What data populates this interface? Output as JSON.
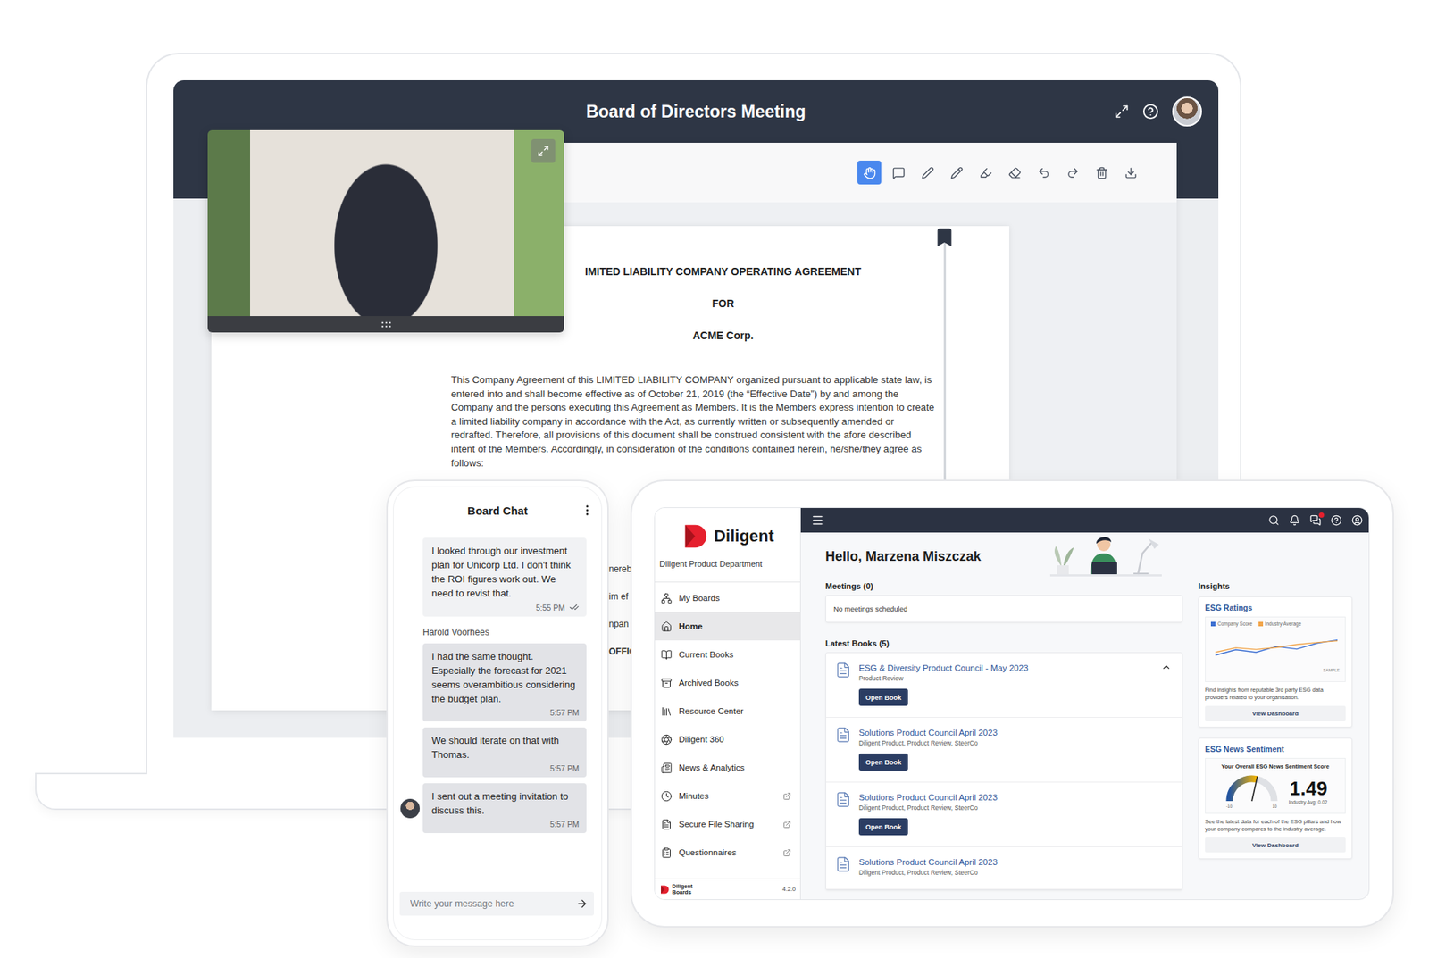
{
  "laptop": {
    "title": "Board of Directors Meeting",
    "tools": [
      {
        "selected": true
      },
      {
        "selected": false
      },
      {
        "selected": false
      },
      {
        "selected": false
      },
      {
        "selected": false
      },
      {
        "selected": false
      },
      {
        "selected": false
      },
      {
        "selected": false
      },
      {
        "selected": false
      },
      {
        "selected": false
      }
    ],
    "document": {
      "bookmarked": true,
      "title_lines": [
        "IMITED LIABILITY COMPANY OPERATING AGREEMENT",
        "FOR",
        "ACME Corp."
      ],
      "body": "This Company Agreement of this LIMITED LIABILITY COMPANY organized pursuant to applicable state law, is entered into and shall become effective as of October 21, 2019 (the “Effective Date”) by and among the Company and the persons executing this Agreement as Members. It is the Members express intention to create a limited liability company in accordance with the Act, as currently written or subsequently amended or redrafted. Therefore, all provisions of this document shall be construed consistent with the afore described intent of the Members. Accordingly, in consideration of the conditions contained herein, he/she/they agree as follows:",
      "fragments": [
        "nereb",
        "im ef",
        "npan",
        "OFFIC"
      ]
    }
  },
  "chat": {
    "title": "Board Chat",
    "messages": [
      {
        "own": true,
        "avatar": false,
        "read": true,
        "text": "I looked through our investment plan for Unicorp Ltd. I don't think the ROI figures work out. We need to revist that.",
        "time": "5:55 PM"
      },
      {
        "own": false,
        "avatar": false,
        "read": false,
        "sender": "Harold Voorhees",
        "text": "I had the same thought. Especially the forecast for 2021 seems overambitious considering the budget plan.",
        "time": "5:57 PM"
      },
      {
        "own": false,
        "avatar": false,
        "read": false,
        "text": "We should iterate on that with Thomas.",
        "time": "5:57 PM"
      },
      {
        "own": false,
        "avatar": true,
        "read": false,
        "text": "I sent out a meeting invitation to discuss this.",
        "time": "5:57 PM"
      }
    ],
    "input_placeholder": "Write your message here"
  },
  "dashboard": {
    "brand": {
      "name": "Diligent",
      "department": "Diligent Product Department"
    },
    "nav": [
      {
        "label": "My Boards",
        "selected": false,
        "external": false
      },
      {
        "label": "Home",
        "selected": true,
        "external": false
      },
      {
        "label": "Current Books",
        "selected": false,
        "external": false
      },
      {
        "label": "Archived Books",
        "selected": false,
        "external": false
      },
      {
        "label": "Resource Center",
        "selected": false,
        "external": false
      },
      {
        "label": "Diligent 360",
        "selected": false,
        "external": false
      },
      {
        "label": "News & Analytics",
        "selected": false,
        "external": false
      },
      {
        "label": "Minutes",
        "selected": false,
        "external": true
      },
      {
        "label": "Secure File Sharing",
        "selected": false,
        "external": true
      },
      {
        "label": "Questionnaires",
        "selected": false,
        "external": true
      }
    ],
    "footer": {
      "brand": "Diligent",
      "product": "Boards",
      "version": "4.2.0"
    },
    "topbar": {
      "unread_messages": true
    },
    "greeting": "Hello, Marzena Miszczak",
    "meetings": {
      "label": "Meetings (0)",
      "empty": "No meetings scheduled"
    },
    "books": {
      "label": "Latest Books (5)",
      "items": [
        {
          "title": "ESG & Diversity Product Council - May 2023",
          "tags": "Product Review",
          "button": "Open Book",
          "expanded": true
        },
        {
          "title": "Solutions Product Council April 2023",
          "tags": "Diligent Product, Product Review, SteerCo",
          "button": "Open Book",
          "expanded": false
        },
        {
          "title": "Solutions Product Council April 2023",
          "tags": "Diligent Product, Product Review, SteerCo",
          "button": "Open Book",
          "expanded": false
        },
        {
          "title": "Solutions Product Council April 2023",
          "tags": "Diligent Product, Product Review, SteerCo",
          "expanded": false
        }
      ]
    },
    "insights": {
      "label": "Insights",
      "ratings": {
        "title": "ESG Ratings",
        "series": [
          {
            "label": "Company Score",
            "color": "#3d6fd1",
            "values": [
              2.5,
              4.2,
              3.4,
              5.2,
              4.4,
              6.2,
              7.2
            ]
          },
          {
            "label": "Industry Average",
            "color": "#f2a54a",
            "values": [
              3.4,
              4.8,
              4.3,
              4.9,
              5.8,
              6.4,
              6.9
            ]
          }
        ],
        "badge": "SAMPLE",
        "text": "Find insights from reputable 3rd party ESG data providers related to your organisation.",
        "button": "View Dashboard"
      },
      "sentiment": {
        "title": "ESG News Sentiment",
        "subtitle": "Your Overall ESG News Sentiment Score",
        "score": "1.49",
        "level": 0.57,
        "min": "-10",
        "max": "10",
        "industry": "Industry Avg: 0.02",
        "text": "See the latest data for each of the ESG pillars and how your company compares to the industry average.",
        "button": "View Dashboard"
      }
    }
  }
}
